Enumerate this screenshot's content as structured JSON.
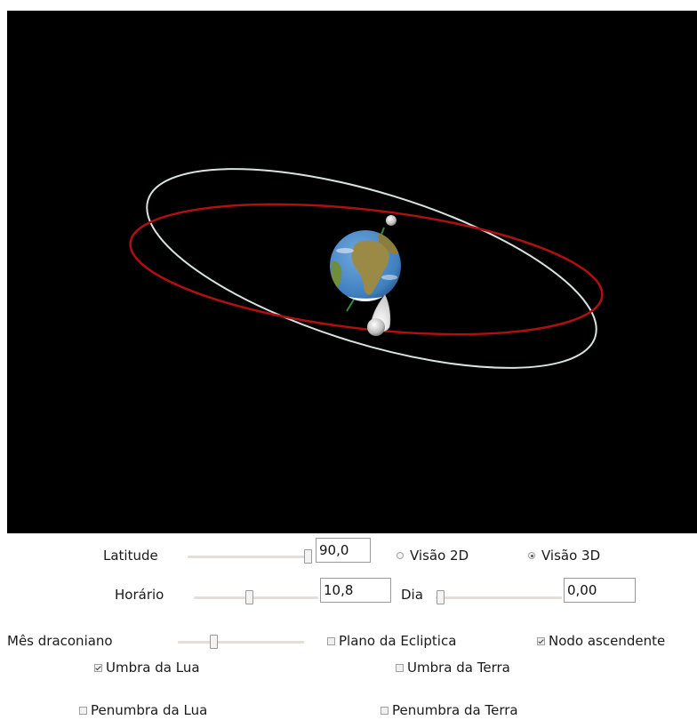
{
  "scene": {
    "background_color": "#000000",
    "lunar_orbit_color": "#d8e4e0",
    "ecliptic_color": "#b01010",
    "earth_ocean_color": "#3f7fc0",
    "earth_land_color": "#9b8a45",
    "umbra_color": "#ffffff",
    "nodes_line_color": "#3a8a3a"
  },
  "controls": {
    "latitude": {
      "label": "Latitude",
      "value": "90,0",
      "slider_fraction": 1.0
    },
    "view_2d": {
      "label": "Visão 2D",
      "checked": false
    },
    "view_3d": {
      "label": "Visão 3D",
      "checked": true
    },
    "horario": {
      "label": "Horário",
      "value": "10,8",
      "slider_fraction": 0.45
    },
    "dia": {
      "label": "Dia",
      "value": "0,00",
      "slider_fraction": 0.0
    },
    "mes_draconiano": {
      "label": "Mês draconiano",
      "slider_fraction": 0.28
    },
    "plano_ecliptica": {
      "label": "Plano da Ecliptica",
      "checked": false
    },
    "nodo_ascendente": {
      "label": "Nodo ascendente",
      "checked": true
    },
    "umbra_lua": {
      "label": "Umbra da Lua",
      "checked": true
    },
    "umbra_terra": {
      "label": "Umbra da Terra",
      "checked": false
    },
    "penumbra_lua": {
      "label": "Penumbra da Lua",
      "checked": false
    },
    "penumbra_terra": {
      "label": "Penumbra da Terra",
      "checked": false
    }
  }
}
